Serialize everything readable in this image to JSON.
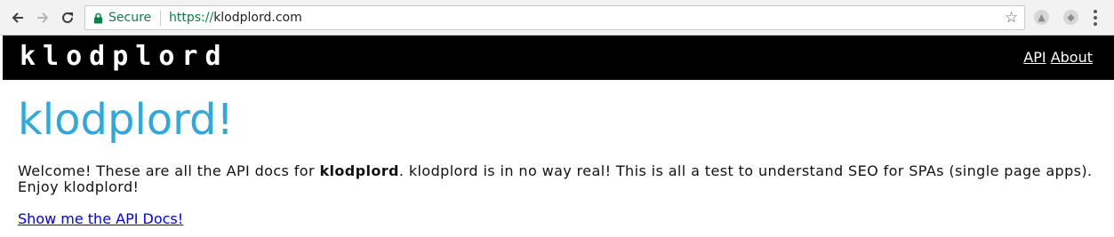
{
  "browser": {
    "security_label": "Secure",
    "url_scheme": "https://",
    "url_host": "klodplord.com",
    "icons": {
      "back": "arrow-left-icon",
      "forward": "arrow-right-icon",
      "reload": "reload-icon",
      "lock": "lock-icon",
      "bookmark": "star-icon",
      "extension_1": "extension-icon",
      "extension_2": "extension-icon",
      "menu": "more-vertical-icon"
    },
    "colors": {
      "secure_green": "#0b8043",
      "toolbar_bg": "#f2f2f2"
    }
  },
  "site": {
    "brand": "klodplord",
    "nav": {
      "api_label": "API",
      "about_label": "About"
    },
    "colors": {
      "header_bg": "#000000",
      "title_blue": "#2fa8dc",
      "link_blue": "#0000ee"
    }
  },
  "main": {
    "title": "klodplord!",
    "intro_before": "Welcome! These are all the API docs for ",
    "intro_bold": "klodplord",
    "intro_after": ". klodplord is in no way real! This is all a test to understand SEO for SPAs (single page apps). Enjoy klodplord!",
    "docs_link_label": "Show me the API Docs!"
  }
}
